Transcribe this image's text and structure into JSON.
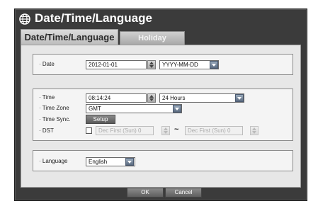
{
  "window": {
    "title": "Date/Time/Language"
  },
  "tabs": [
    {
      "label": "Date/Time/Language",
      "active": true
    },
    {
      "label": "Holiday",
      "active": false
    }
  ],
  "date_section": {
    "date_label": "· Date",
    "date_value": "2012-01-01",
    "format_value": "YYYY-MM-DD"
  },
  "time_section": {
    "time_label": "· Time",
    "time_value": "08:14:24",
    "hour_format_value": "24 Hours",
    "timezone_label": "· Time Zone",
    "timezone_value": "GMT",
    "timesync_label": "· Time Sync.",
    "setup_label": "Setup",
    "dst_label": "· DST",
    "dst_checked": false,
    "dst_start_value": "Dec First (Sun) 0",
    "dst_separator": "~",
    "dst_end_value": "Dec First (Sun) 0"
  },
  "language_section": {
    "language_label": "· Language",
    "language_value": "English"
  },
  "footer": {
    "ok_label": "OK",
    "cancel_label": "Cancel"
  },
  "colors": {
    "window_bg": "#3b3b3b",
    "panel_bg": "#e7e7e7",
    "accent": "#5a6a80"
  },
  "icons": {
    "title_icon": "globe-icon"
  }
}
